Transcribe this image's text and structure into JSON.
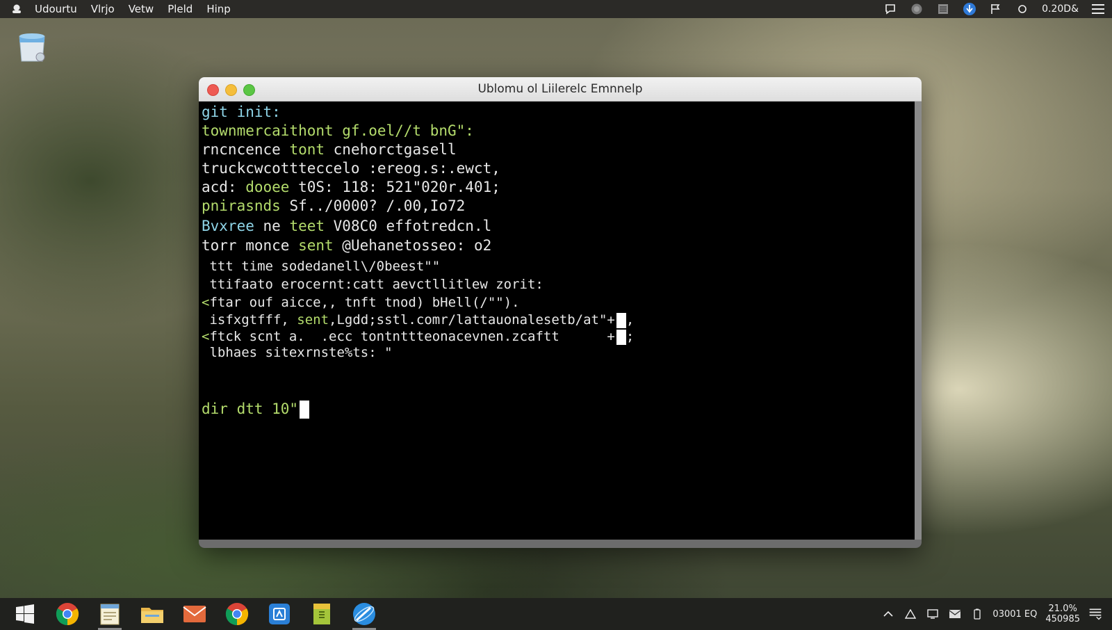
{
  "topbar": {
    "menu": [
      "Udourtu",
      "Vlrjo",
      "Vetw",
      "Pleld",
      "Hinp"
    ],
    "clock": "0.20D&"
  },
  "window": {
    "title": "Ublomu ol Liilerelc Emnnelp"
  },
  "terminal": {
    "lines": [
      {
        "text": "git init:",
        "color": "#8fd5e8"
      },
      {
        "parts": [
          {
            "t": "townmercaithont gf.oel//t bnG\":",
            "c": "#b4dc6c"
          }
        ]
      },
      {
        "parts": [
          {
            "t": "rncncence ",
            "c": "#e8e8e8"
          },
          {
            "t": "tont",
            "c": "#b4dc6c"
          },
          {
            "t": " cnehorctgasell",
            "c": "#e8e8e8"
          }
        ]
      },
      {
        "parts": [
          {
            "t": "truckcwcottteccelo :ereog.s:.ewct,",
            "c": "#e8e8e8"
          }
        ]
      },
      {
        "parts": [
          {
            "t": "acd: ",
            "c": "#e8e8e8"
          },
          {
            "t": "dooee",
            "c": "#b4dc6c"
          },
          {
            "t": " t0S: 118: 521\"020r.401;",
            "c": "#e8e8e8"
          }
        ]
      },
      {
        "parts": [
          {
            "t": "pnirasnds",
            "c": "#b4dc6c"
          },
          {
            "t": " Sf../0000? /.00,Io72",
            "c": "#e8e8e8"
          }
        ]
      },
      {
        "parts": [
          {
            "t": "Bvxree",
            "c": "#8fd5e8"
          },
          {
            "t": " ne ",
            "c": "#e8e8e8"
          },
          {
            "t": "teet",
            "c": "#b4dc6c"
          },
          {
            "t": " V08C0 effotredcn.l",
            "c": "#e8e8e8"
          }
        ]
      },
      {
        "parts": [
          {
            "t": "torr monce ",
            "c": "#e8e8e8"
          },
          {
            "t": "sent",
            "c": "#b4dc6c"
          },
          {
            "t": " @Uehanetosseo: o2",
            "c": "#e8e8e8"
          }
        ]
      },
      {
        "parts": [
          {
            "t": " ttt time sodedanell\\/0beest\"\"",
            "c": "#e8e8e8"
          }
        ]
      },
      {
        "parts": [
          {
            "t": " ttifaato erocernt:catt aevctllitlew zorit:",
            "c": "#e8e8e8"
          }
        ]
      },
      {
        "parts": [
          {
            "t": "<",
            "c": "#b4dc6c"
          },
          {
            "t": "ftar ouf aicce,, tnft tnod) bHell(/\"\").",
            "c": "#e8e8e8"
          }
        ]
      },
      {
        "parts": [
          {
            "t": " isfxgtfff, ",
            "c": "#e8e8e8"
          },
          {
            "t": "sent",
            "c": "#b4dc6c"
          },
          {
            "t": ",Lgdd;sstl.comr/lattauonalesetb/at\"+",
            "c": "#e8e8e8"
          }
        ]
      },
      {
        "parts": [
          {
            "t": "<",
            "c": "#b4dc6c"
          },
          {
            "t": "ftck scnt a.  .ecc tontnttteonacevnen.zcaftt      +",
            "c": "#e8e8e8"
          }
        ]
      },
      {
        "parts": [
          {
            "t": " lbhaes sitexrnste%ts: \"",
            "c": "#e8e8e8"
          }
        ]
      }
    ],
    "line_tails": [
      ",",
      ";"
    ],
    "prompt": "dir dtt 10\""
  },
  "taskbar": {
    "apps": [
      "chrome-icon",
      "notepad-icon",
      "file-manager-icon",
      "mail-icon",
      "chrome-icon",
      "store-icon",
      "archive-icon",
      "browser-icon"
    ],
    "tray_text": "03001 EQ",
    "clock_time": "21.0%",
    "clock_date": "450985"
  },
  "colors": {
    "terminal_bg": "#000000",
    "prompt_green": "#b4dc6c",
    "cmd_cyan": "#8fd5e8"
  }
}
